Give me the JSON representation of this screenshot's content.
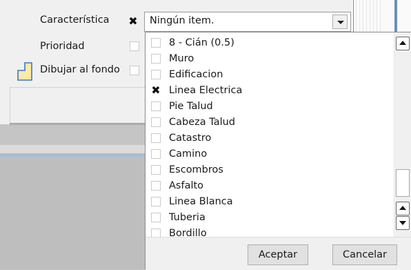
{
  "form": {
    "caracteristica_label": "Característica",
    "prioridad_label": "Prioridad",
    "dibujar_label": "Dibujar al fondo"
  },
  "combo": {
    "value": "Ningún item."
  },
  "list": {
    "items": [
      {
        "label": "8 - Cián (0.5)",
        "checked": false
      },
      {
        "label": "Muro",
        "checked": false
      },
      {
        "label": "Edificacion",
        "checked": false
      },
      {
        "label": "Linea Electrica",
        "checked": true
      },
      {
        "label": "Pie Talud",
        "checked": false
      },
      {
        "label": "Cabeza Talud",
        "checked": false
      },
      {
        "label": "Catastro",
        "checked": false
      },
      {
        "label": "Camino",
        "checked": false
      },
      {
        "label": "Escombros",
        "checked": false
      },
      {
        "label": "Asfalto",
        "checked": false
      },
      {
        "label": "Linea Blanca",
        "checked": false
      },
      {
        "label": "Tuberia",
        "checked": false
      },
      {
        "label": "Bordillo",
        "checked": false
      }
    ]
  },
  "buttons": {
    "accept": "Aceptar",
    "cancel": "Cancelar"
  },
  "icons": {
    "check": "x-check-icon",
    "layer": "layer-icon",
    "dropdown": "chevron-down-icon",
    "scroll_up": "arrow-up-icon",
    "scroll_down": "arrow-down-icon"
  },
  "colors": {
    "layer_fill": "#fde9a8",
    "layer_stroke": "#3d76c4",
    "accent_blue": "#6d8db8"
  }
}
